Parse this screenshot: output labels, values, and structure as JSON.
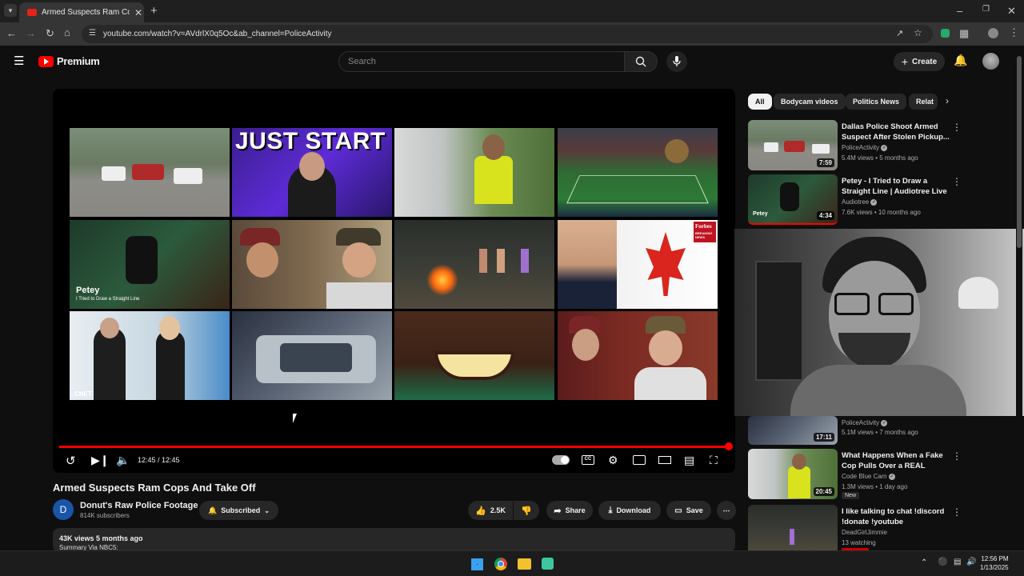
{
  "browser": {
    "tab_title": "Armed Suspects Ram Cops And Take Off",
    "url": "youtube.com/watch?v=AVdrlX0q5Oc&ab_channel=PoliceActivity"
  },
  "header": {
    "brand": "Premium",
    "search_placeholder": "Search",
    "create_label": "Create"
  },
  "player": {
    "thumbnail_labels": {
      "just_start": "JUST START",
      "petey": "Petey",
      "petey_sub": "I Tried to Draw a Straight Line",
      "forbes": "Forbes",
      "forbes_sub": "BREAKING NEWS",
      "cnet": "CNET"
    },
    "time": "12:45 / 12:45",
    "progress": 1.0
  },
  "video": {
    "title": "Armed Suspects Ram Cops And Take Off",
    "channel_initial": "D",
    "channel_name": "Donut's Raw Police Footage",
    "subscribers": "814K subscribers",
    "subscribed_label": "Subscribed",
    "likes": "2.5K",
    "share_label": "Share",
    "download_label": "Download",
    "save_label": "Save",
    "views_date": "43K views  5 months ago",
    "summary": "Summary Via NBC5:"
  },
  "chips": [
    "All",
    "Bodycam videos",
    "Politics News",
    "Relat"
  ],
  "recommendations": [
    {
      "title": "Dallas Police Shoot Armed Suspect After Stolen Pickup...",
      "channel": "PoliceActivity",
      "meta": "5.4M views • 5 months ago",
      "duration": "7:59"
    },
    {
      "title": "Petey - I Tried to Draw a Straight Line | Audiotree Live",
      "channel": "Audiotree",
      "meta": "7.6K views • 10 months ago",
      "duration": "4:34"
    },
    {
      "title": "",
      "channel": "PoliceActivity",
      "meta": "5.1M views • 7 months ago",
      "duration": "17:11"
    },
    {
      "title": "What Happens When a Fake Cop Pulls Over a REAL Police...",
      "channel": "Code Blue Cam",
      "meta": "1.3M views • 1 day ago",
      "duration": "20:45",
      "badge": "New"
    },
    {
      "title": "I like talking to chat !discord !donate !youtube",
      "channel": "DeadGirlJimmie",
      "meta": "13 watching",
      "duration": ""
    }
  ],
  "taskbar": {
    "time": "12:56 PM",
    "date": "1/13/2025"
  }
}
